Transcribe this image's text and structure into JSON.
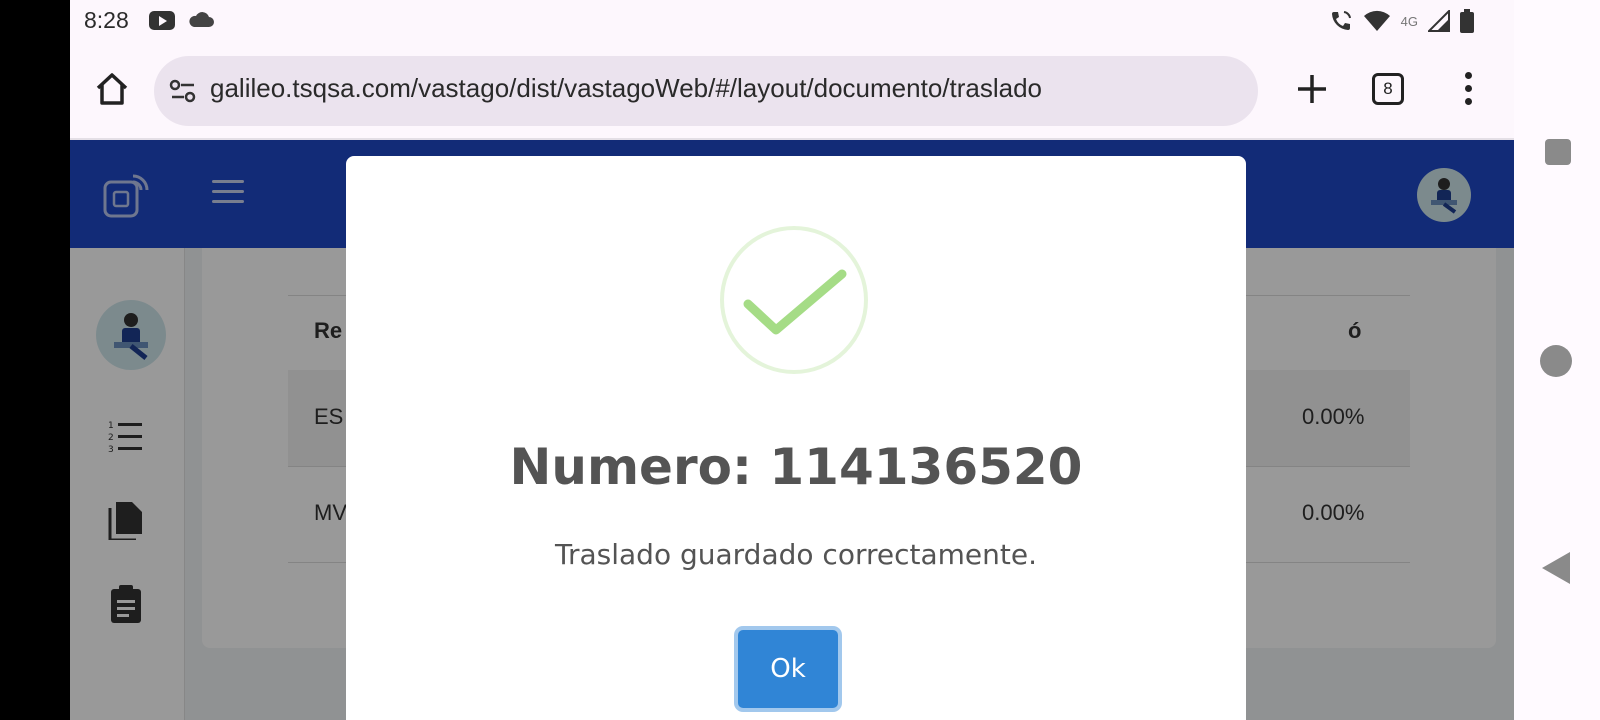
{
  "status_bar": {
    "time": "8:28",
    "network_label": "4G",
    "icons": [
      "youtube-icon",
      "cloud-icon",
      "wifi-call-icon",
      "wifi-icon",
      "signal-icon",
      "battery-icon"
    ]
  },
  "browser": {
    "url": "galileo.tsqsa.com/vastago/dist/vastagoWeb/#/layout/documento/traslado",
    "tab_count": "8",
    "icons": [
      "home-icon",
      "site-settings-icon",
      "plus-icon",
      "tabs-icon",
      "more-vert-icon"
    ]
  },
  "app": {
    "header_color": "#1f49c6",
    "table": {
      "header_left": "Re",
      "header_right": "ó",
      "rows": [
        {
          "left": "ES",
          "right": "0.00%"
        },
        {
          "left": "MV",
          "right": "0.00%"
        }
      ]
    },
    "sidebar_icons": [
      "numbered-list-icon",
      "document-icon",
      "clipboard-icon"
    ]
  },
  "modal": {
    "icon": "success-check-icon",
    "title": "Numero: 114136520",
    "message": "Traslado guardado correctamente.",
    "ok_label": "Ok",
    "accent_color": "#3085d6",
    "check_color": "#a5dc86"
  },
  "android_nav": {
    "icons": [
      "recents-icon",
      "home-icon",
      "back-icon"
    ]
  }
}
